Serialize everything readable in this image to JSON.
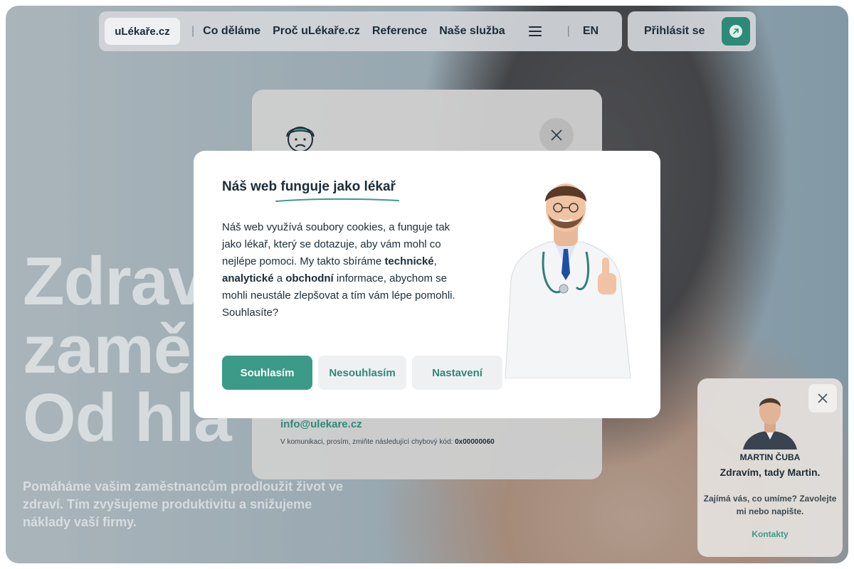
{
  "nav": {
    "logo": "uLékaře.cz",
    "separator": "|",
    "links": [
      "Co děláme",
      "Proč uLékaře.cz",
      "Reference",
      "Naše služba"
    ],
    "language": "EN",
    "login_label": "Přihlásit se"
  },
  "hero": {
    "title_lines": [
      "Zdrav",
      "zaměs",
      "Od hla"
    ],
    "subtitle": "Pomáháme vašim zaměstnancům prodloužit život ve zdraví. Tím zvyšujeme produktivitu a snižujeme náklady vaší firmy."
  },
  "error_modal": {
    "email": "info@ulekare.cz",
    "note": "V komunikaci, prosím, zmiňte následující chybový kód:",
    "code": "0x00000060"
  },
  "cookie_dialog": {
    "title": "Náš web funguje jako lékař",
    "text_part1": "Náš web využívá soubory cookies, a funguje tak jako lékař, který se dotazuje, aby vám mohl co nejlépe pomoci. My takto sbíráme ",
    "bold1": "technické",
    "sep1": ", ",
    "bold2": "analytické",
    "sep2": " a ",
    "bold3": "obchodní",
    "text_part2": " informace, abychom se mohli neustále zlepšovat a tím vám lépe pomohli. Souhlasíte?",
    "accept": "Souhlasím",
    "reject": "Nesouhlasím",
    "settings": "Nastavení"
  },
  "chat": {
    "name": "MARTIN ČUBA",
    "greeting": "Zdravím, tady Martin.",
    "message": "Zajímá vás, co umíme? Zavolejte mi nebo napište.",
    "link": "Kontakty"
  },
  "colors": {
    "accent": "#3c9a88",
    "text_dark": "#1d2c38"
  }
}
